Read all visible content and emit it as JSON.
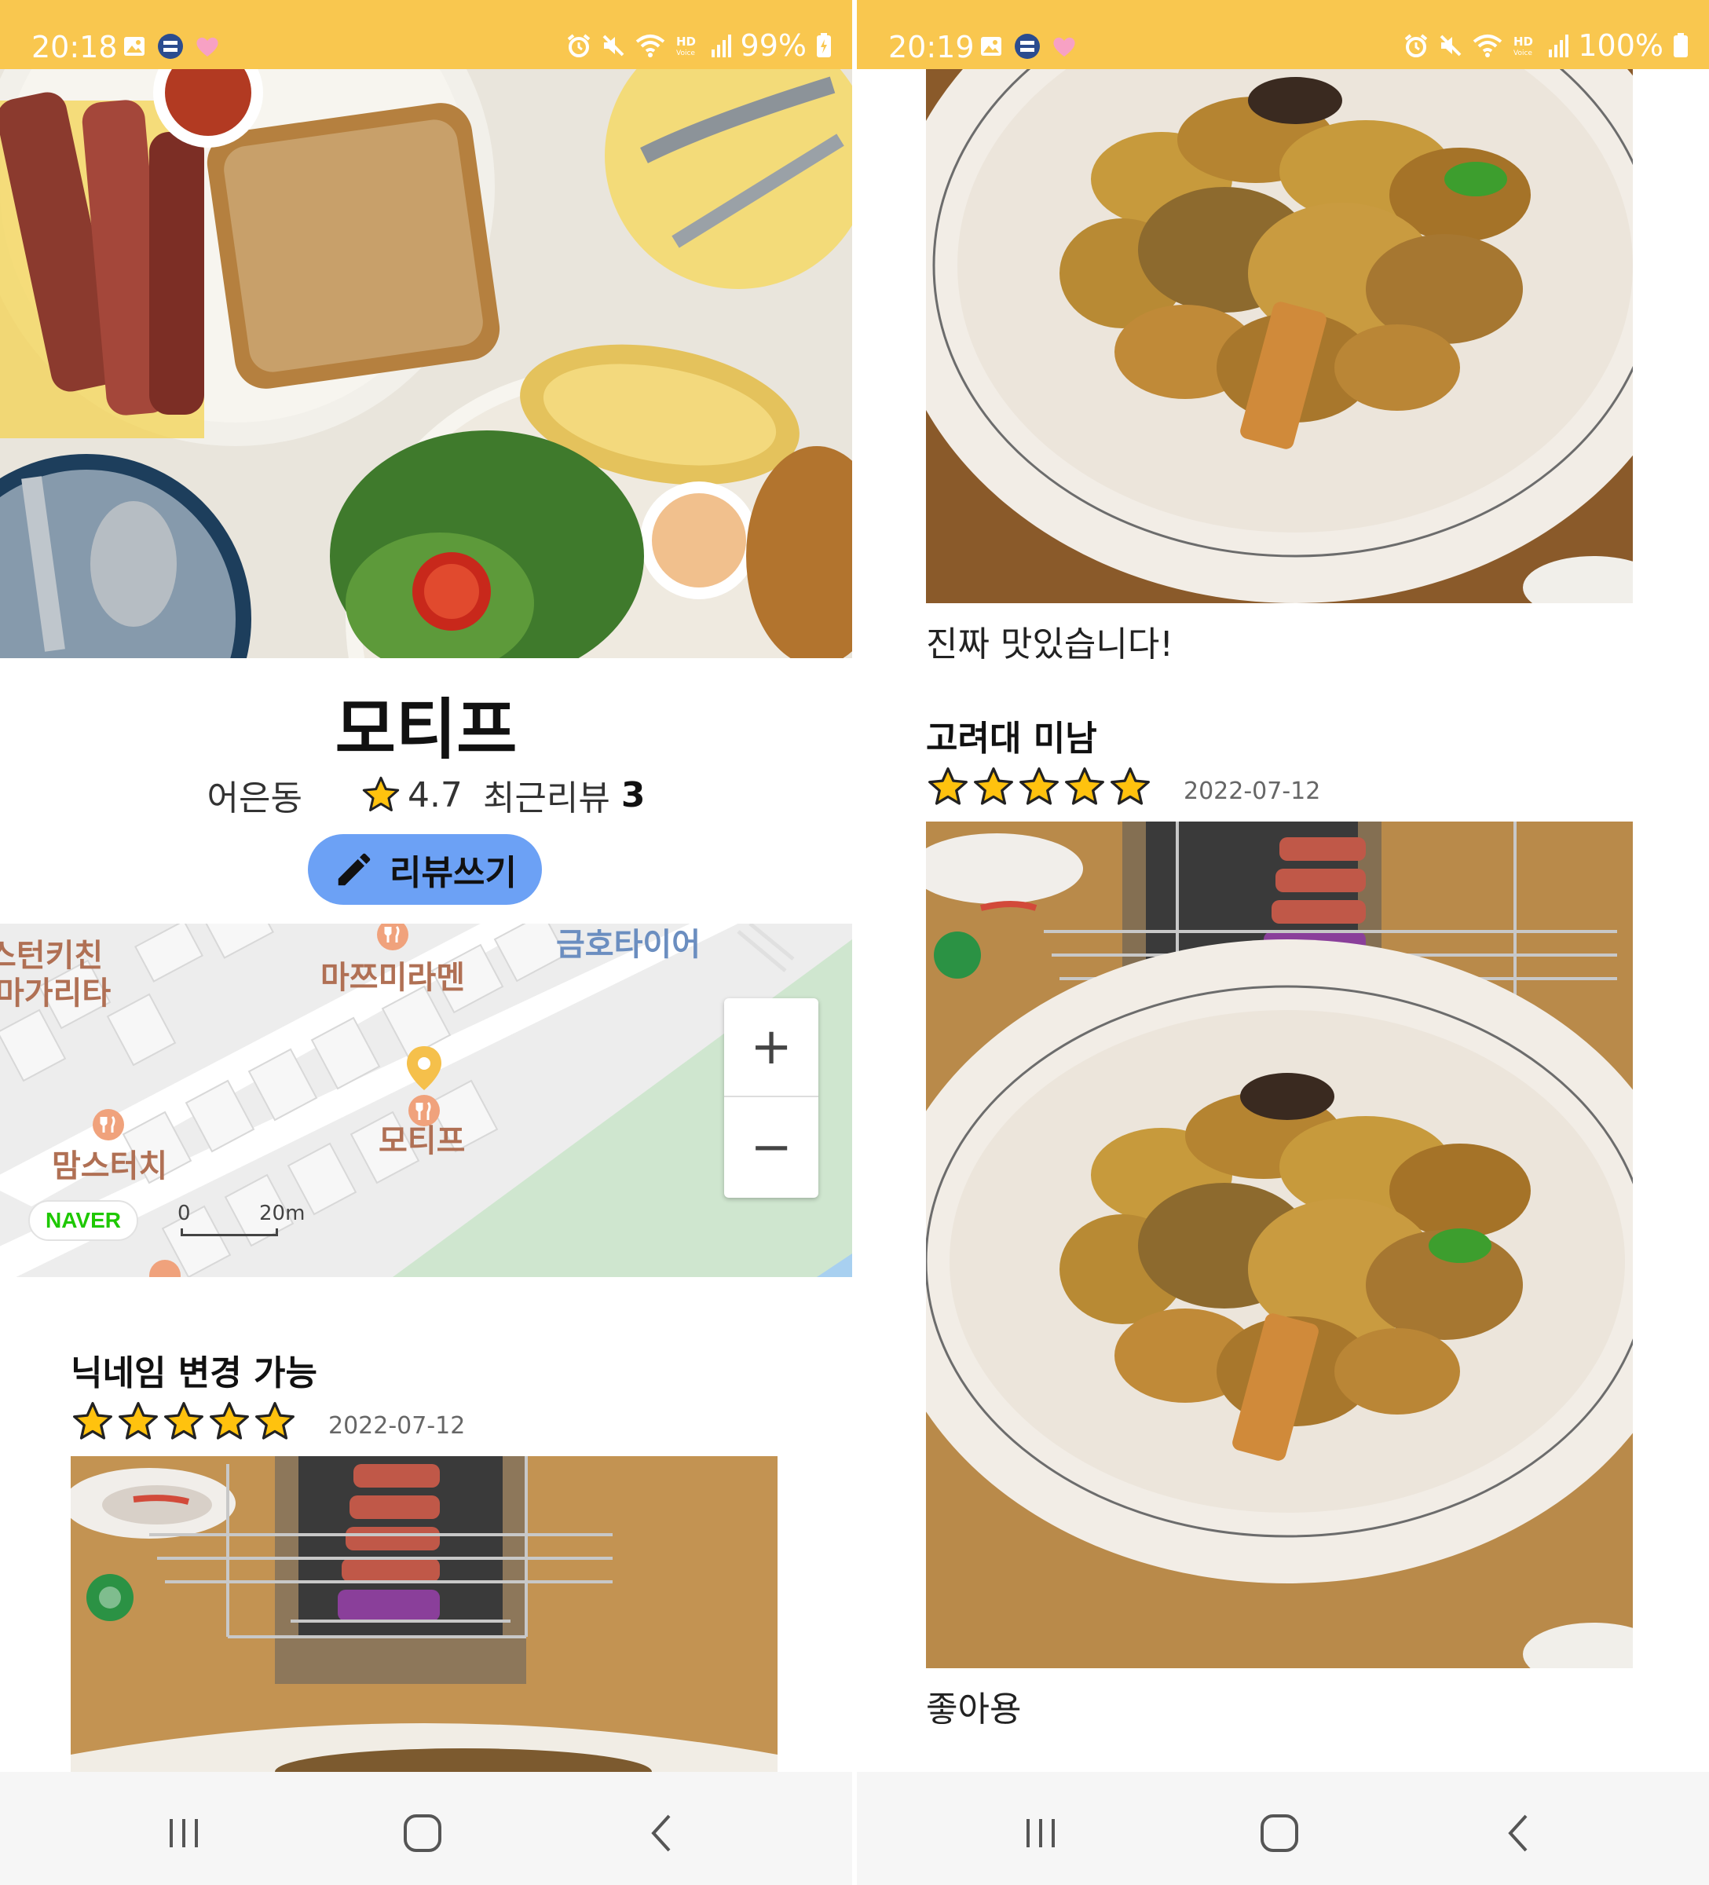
{
  "colors": {
    "status_bar": "#F9C74F",
    "write_button": "#6CA1F5",
    "star_fill": "#FFC20E",
    "map_park": "#CFE6CF",
    "map_label": "#B07054",
    "naver_green": "#1EC800"
  },
  "left": {
    "status": {
      "time": "20:18",
      "battery": "99%"
    },
    "restaurant": {
      "name": "모티프",
      "area": "어은동",
      "rating": "4.7",
      "recent_reviews_label": "최근리뷰",
      "recent_reviews_count": "3",
      "write_review_label": "리뷰쓰기"
    },
    "map": {
      "labels": {
        "kitchen": "스턴키친",
        "margarita": "마가리타",
        "mazzmi": "마쯔미라멘",
        "kumho": "금호타이어",
        "mamstouch": "맘스터치",
        "motif": "모티프"
      },
      "zoom_in": "+",
      "zoom_out": "−",
      "naver": "NAVER",
      "scale_start": "0",
      "scale_end": "20m"
    },
    "review": {
      "nickname": "닉네임 변경 가능",
      "stars": 5,
      "date": "2022-07-12"
    }
  },
  "right": {
    "status": {
      "time": "20:19",
      "battery": "100%"
    },
    "review_prev": {
      "text": "진짜 맛있습니다!"
    },
    "review": {
      "nickname": "고려대 미남",
      "stars": 5,
      "date": "2022-07-12",
      "text": "좋아용"
    }
  },
  "icons": {
    "status_left": [
      "gallery-icon",
      "hanguk-app-icon",
      "heart-icon"
    ],
    "status_right": [
      "alarm-icon",
      "mute-icon",
      "wifi-icon",
      "hd-voice-icon",
      "signal-icon",
      "battery-icon"
    ],
    "navigation": [
      "recent-apps-icon",
      "home-icon",
      "back-icon"
    ]
  }
}
